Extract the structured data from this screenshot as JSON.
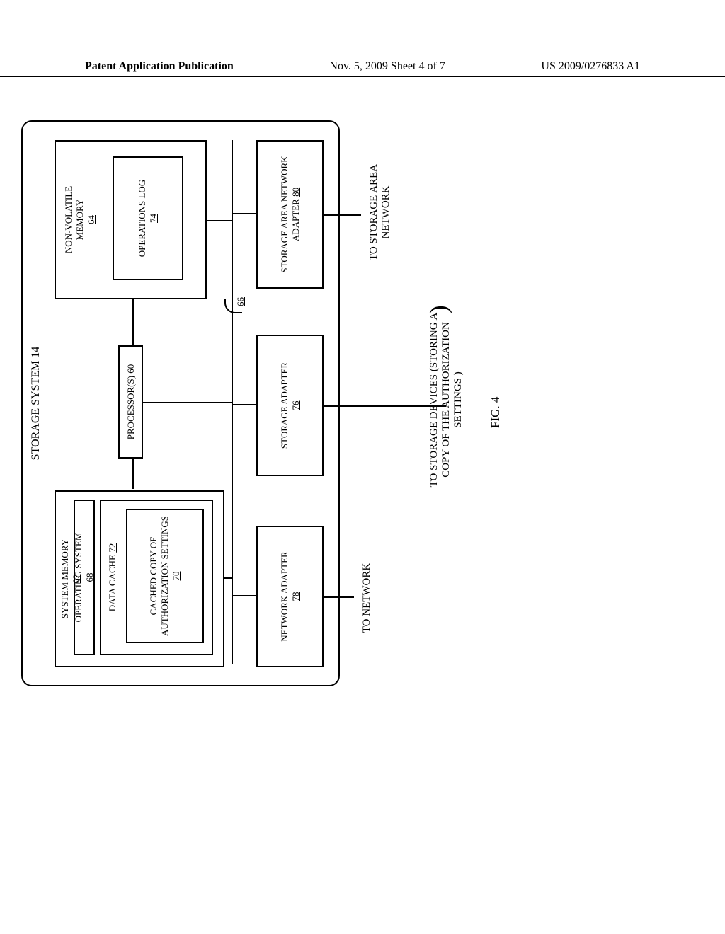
{
  "header": {
    "left": "Patent Application Publication",
    "center": "Nov. 5, 2009  Sheet 4 of 7",
    "right": "US 2009/0276833 A1"
  },
  "diagram": {
    "title": "STORAGE SYSTEM ",
    "title_ref": "14",
    "system_memory": {
      "label": "SYSTEM MEMORY ",
      "ref": "62"
    },
    "operating_system": {
      "label": "OPERATING SYSTEM ",
      "ref": "68"
    },
    "data_cache": {
      "label": "DATA CACHE ",
      "ref": "72"
    },
    "cached_copy": {
      "label": "CACHED COPY OF AUTHORIZATION SETTINGS ",
      "ref": "70"
    },
    "processors": {
      "label": "PROCESSOR(S) ",
      "ref": "60"
    },
    "nonvolatile": {
      "label": "NON-VOLATILE MEMORY",
      "ref": "64"
    },
    "operations_log": {
      "label": "OPERATIONS LOG ",
      "ref": "74"
    },
    "network_adapter": {
      "label": "NETWORK ADAPTER",
      "ref": "78"
    },
    "storage_adapter": {
      "label": "STORAGE ADAPTER",
      "ref": "76"
    },
    "san_adapter": {
      "label": "STORAGE AREA NETWORK ADAPTER ",
      "ref": "80"
    },
    "bus_ref": "66",
    "ext_network": "TO NETWORK",
    "ext_storage_devices": "TO STORAGE DEVICES (STORING A COPY OF THE AUTHORIZATION SETTINGS )",
    "ext_san": "TO STORAGE AREA NETWORK",
    "figure_label": "FIG. 4"
  }
}
